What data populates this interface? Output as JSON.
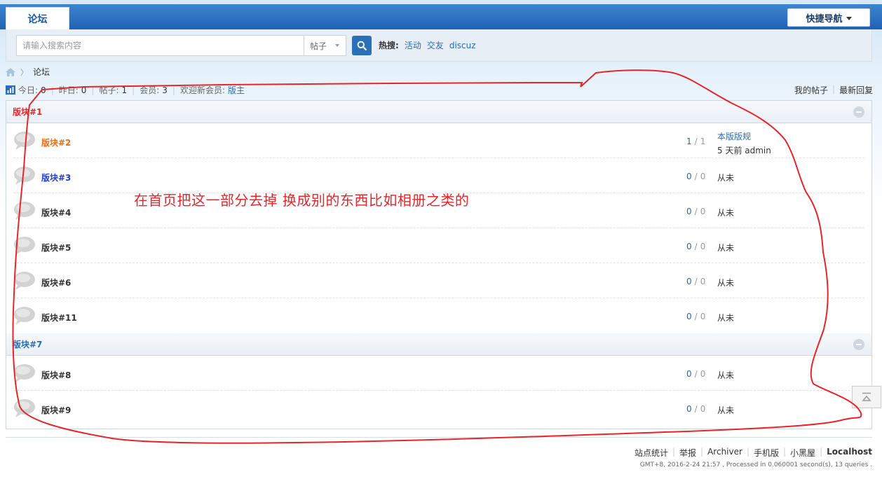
{
  "header": {
    "tab_label": "论坛",
    "quicknav_label": "快捷导航"
  },
  "search": {
    "placeholder": "请输入搜索内容",
    "type_selected": "帖子",
    "hot_label": "热搜:",
    "hot_links": [
      "活动",
      "交友",
      "discuz"
    ]
  },
  "breadcrumb": {
    "current": "论坛"
  },
  "stats": {
    "today_label": "今日:",
    "today": "0",
    "yesterday_label": "昨日:",
    "yesterday": "0",
    "posts_label": "帖子:",
    "posts": "1",
    "members_label": "会员:",
    "members": "3",
    "welcome_label": "欢迎新会员:",
    "new_member": "版主"
  },
  "right_links": [
    "我的帖子",
    "最新回复"
  ],
  "categories": [
    {
      "title": "版块#1",
      "title_color": "#e8262a",
      "forums": [
        {
          "name": "版块#2",
          "color": "#f26c0c",
          "threads": "1",
          "posts": "1",
          "lastpost_title": "本版版规",
          "lastpost_meta": "5 天前 admin"
        },
        {
          "name": "版块#3",
          "color": "#1f3fd6",
          "threads": "0",
          "posts": "0",
          "lastpost_title": "",
          "lastpost_meta": "从未"
        },
        {
          "name": "版块#4",
          "color": "#333333",
          "threads": "0",
          "posts": "0",
          "lastpost_title": "",
          "lastpost_meta": "从未"
        },
        {
          "name": "版块#5",
          "color": "#333333",
          "threads": "0",
          "posts": "0",
          "lastpost_title": "",
          "lastpost_meta": "从未"
        },
        {
          "name": "版块#6",
          "color": "#333333",
          "threads": "0",
          "posts": "0",
          "lastpost_title": "",
          "lastpost_meta": "从未"
        },
        {
          "name": "版块#11",
          "color": "#333333",
          "threads": "0",
          "posts": "0",
          "lastpost_title": "",
          "lastpost_meta": "从未"
        }
      ]
    },
    {
      "title": "版块#7",
      "title_color": "#2a6db5",
      "forums": [
        {
          "name": "版块#8",
          "color": "#333333",
          "threads": "0",
          "posts": "0",
          "lastpost_title": "",
          "lastpost_meta": "从未"
        },
        {
          "name": "版块#9",
          "color": "#333333",
          "threads": "0",
          "posts": "0",
          "lastpost_title": "",
          "lastpost_meta": "从未"
        }
      ]
    }
  ],
  "count_separator": "/",
  "footer": {
    "links": [
      "站点统计",
      "举报",
      "Archiver",
      "手机版",
      "小黑屋"
    ],
    "site": "Localhost",
    "info": "GMT+8, 2016-2-24 21:57 , Processed in 0.060001 second(s), 13 queries ."
  },
  "annotation": {
    "text": "在首页把这一部分去掉 换成别的东西比如相册之类的",
    "color": "#e8262a"
  }
}
